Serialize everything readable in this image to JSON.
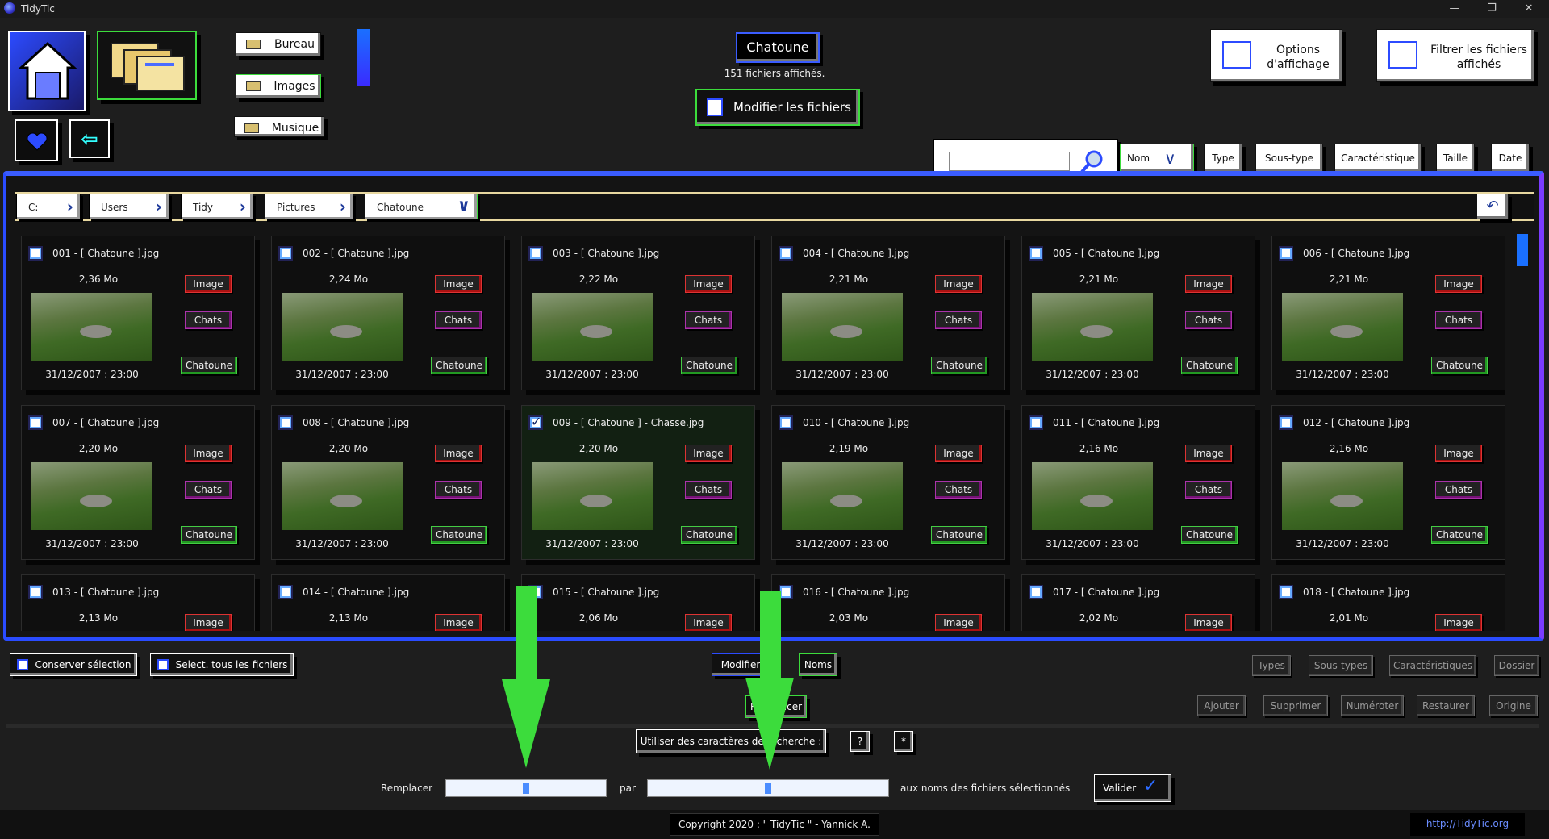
{
  "window": {
    "title": "TidyTic",
    "minimize": "—",
    "maximize": "❐",
    "close": "✕"
  },
  "top": {
    "folders": [
      "Bureau",
      "Images",
      "Musique"
    ],
    "current_folder": "Chatoune",
    "count_text": "151 fichiers affichés.",
    "modify_button": "Modifier les fichiers",
    "display_options": "Options d'affichage",
    "filter_files": "Filtrer les fichiers affichés"
  },
  "sort": {
    "search_value": "",
    "name": "Nom",
    "buttons": [
      "Type",
      "Sous-type",
      "Caractéristique",
      "Taille",
      "Date"
    ]
  },
  "breadcrumb": [
    "C:",
    "Users",
    "Tidy",
    "Pictures",
    "Chatoune"
  ],
  "files": [
    {
      "name": "001 - [ Chatoune ].jpg",
      "size": "2,36 Mo",
      "date": "31/12/2007 : 23:00",
      "type": "Image",
      "subtype": "Chats",
      "tag": "Chatoune",
      "selected": false
    },
    {
      "name": "002 - [ Chatoune ].jpg",
      "size": "2,24 Mo",
      "date": "31/12/2007 : 23:00",
      "type": "Image",
      "subtype": "Chats",
      "tag": "Chatoune",
      "selected": false
    },
    {
      "name": "003 - [ Chatoune ].jpg",
      "size": "2,22 Mo",
      "date": "31/12/2007 : 23:00",
      "type": "Image",
      "subtype": "Chats",
      "tag": "Chatoune",
      "selected": false
    },
    {
      "name": "004 - [ Chatoune ].jpg",
      "size": "2,21 Mo",
      "date": "31/12/2007 : 23:00",
      "type": "Image",
      "subtype": "Chats",
      "tag": "Chatoune",
      "selected": false
    },
    {
      "name": "005 - [ Chatoune ].jpg",
      "size": "2,21 Mo",
      "date": "31/12/2007 : 23:00",
      "type": "Image",
      "subtype": "Chats",
      "tag": "Chatoune",
      "selected": false
    },
    {
      "name": "006 - [ Chatoune ].jpg",
      "size": "2,21 Mo",
      "date": "31/12/2007 : 23:00",
      "type": "Image",
      "subtype": "Chats",
      "tag": "Chatoune",
      "selected": false
    },
    {
      "name": "007 - [ Chatoune ].jpg",
      "size": "2,20 Mo",
      "date": "31/12/2007 : 23:00",
      "type": "Image",
      "subtype": "Chats",
      "tag": "Chatoune",
      "selected": false
    },
    {
      "name": "008 - [ Chatoune ].jpg",
      "size": "2,20 Mo",
      "date": "31/12/2007 : 23:00",
      "type": "Image",
      "subtype": "Chats",
      "tag": "Chatoune",
      "selected": false
    },
    {
      "name": "009 - [ Chatoune ] - Chasse.jpg",
      "size": "2,20 Mo",
      "date": "31/12/2007 : 23:00",
      "type": "Image",
      "subtype": "Chats",
      "tag": "Chatoune",
      "selected": true
    },
    {
      "name": "010 - [ Chatoune ].jpg",
      "size": "2,19 Mo",
      "date": "31/12/2007 : 23:00",
      "type": "Image",
      "subtype": "Chats",
      "tag": "Chatoune",
      "selected": false
    },
    {
      "name": "011 - [ Chatoune ].jpg",
      "size": "2,16 Mo",
      "date": "31/12/2007 : 23:00",
      "type": "Image",
      "subtype": "Chats",
      "tag": "Chatoune",
      "selected": false
    },
    {
      "name": "012 - [ Chatoune ].jpg",
      "size": "2,16 Mo",
      "date": "31/12/2007 : 23:00",
      "type": "Image",
      "subtype": "Chats",
      "tag": "Chatoune",
      "selected": false
    },
    {
      "name": "013 - [ Chatoune ].jpg",
      "size": "2,13 Mo",
      "type": "Image",
      "selected": false
    },
    {
      "name": "014 - [ Chatoune ].jpg",
      "size": "2,13 Mo",
      "type": "Image",
      "selected": false
    },
    {
      "name": "015 - [ Chatoune ].jpg",
      "size": "2,06 Mo",
      "type": "Image",
      "selected": false
    },
    {
      "name": "016 - [ Chatoune ].jpg",
      "size": "2,03 Mo",
      "type": "Image",
      "selected": false
    },
    {
      "name": "017 - [ Chatoune ].jpg",
      "size": "2,02 Mo",
      "type": "Image",
      "selected": false
    },
    {
      "name": "018 - [ Chatoune ].jpg",
      "size": "2,01 Mo",
      "type": "Image",
      "selected": false
    }
  ],
  "bottom": {
    "keep_selection": "Conserver sélection",
    "select_all": "Select. tous les fichiers",
    "modifier": "Modifier",
    "noms": "Noms",
    "remplacer": "Remplacer",
    "right_row1": [
      "Types",
      "Sous-types",
      "Caractéristiques",
      "Dossier"
    ],
    "right_row2": [
      "Ajouter",
      "Supprimer",
      "Numéroter",
      "Restaurer",
      "Origine"
    ],
    "wildcards": "Utiliser des caractères de recherche :",
    "q_mark": "?",
    "star": "*",
    "replace_label": "Remplacer",
    "replace_value": "",
    "by_label": "par",
    "by_value": "",
    "suffix": "aux noms des fichiers sélectionnés",
    "validate": "Valider"
  },
  "footer": {
    "copyright": "Copyright 2020 : \" TidyTic \" - Yannick A.",
    "link": "http://TidyTic.org"
  },
  "colors": {
    "accent_blue": "#2a4cff",
    "accent_purple": "#7b3cff",
    "green": "#3cdc3c",
    "red": "#e02828"
  }
}
